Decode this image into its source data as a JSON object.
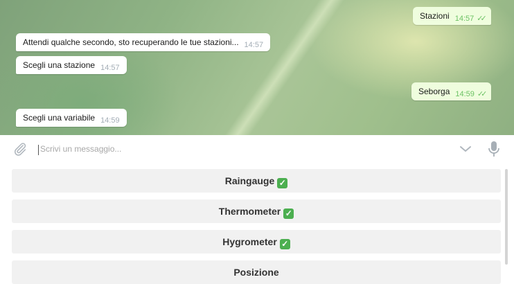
{
  "messages": [
    {
      "text": "Stazioni",
      "time": "14:57",
      "ticks": "✓✓"
    },
    {
      "text": "Attendi qualche secondo, sto recuperando le tue stazioni...",
      "time": "14:57"
    },
    {
      "text": "Scegli una stazione",
      "time": "14:57"
    },
    {
      "text": "Seborga",
      "time": "14:59",
      "ticks": "✓✓"
    },
    {
      "text": "Scegli una variabile",
      "time": "14:59"
    }
  ],
  "input": {
    "placeholder": "Scrivi un messaggio..."
  },
  "keyboard": [
    {
      "label": "Raingauge",
      "checked": true
    },
    {
      "label": "Thermometer",
      "checked": true
    },
    {
      "label": "Hygrometer",
      "checked": true
    },
    {
      "label": "Posizione",
      "checked": false
    }
  ],
  "icons": [
    "paperclip-icon",
    "chevron-down-icon",
    "microphone-icon",
    "check-icon"
  ],
  "colors": {
    "outgoing_bubble": "#effdde",
    "incoming_bubble": "#ffffff",
    "read_ticks": "#6cc264",
    "check": "#4caf50"
  }
}
